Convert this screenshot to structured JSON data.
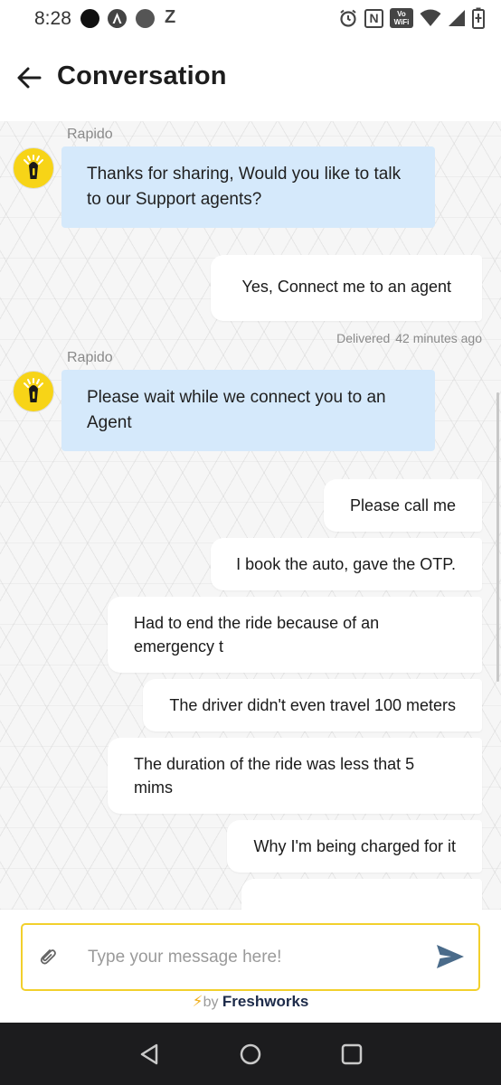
{
  "status_bar": {
    "time": "8:28",
    "icons": [
      "circle-icon",
      "a-circle-icon",
      "dot-icon",
      "z-icon",
      "alarm-icon",
      "nfc-icon",
      "vowifi-icon",
      "wifi-icon",
      "signal-icon",
      "battery-icon"
    ],
    "vowifi_label_top": "Vo",
    "vowifi_label_bottom": "WiFi",
    "z_label": "Z",
    "nfc_label": "N"
  },
  "app_bar": {
    "title": "Conversation"
  },
  "messages": [
    {
      "type": "incoming",
      "sender": "Rapido",
      "text": "Thanks for sharing, Would you like to talk to our Support agents?"
    },
    {
      "type": "outgoing",
      "text": "Yes, Connect me to an agent",
      "status": "Delivered",
      "time": "42 minutes ago"
    },
    {
      "type": "incoming",
      "sender": "Rapido",
      "text": "Please wait while we connect you to an Agent"
    },
    {
      "type": "outgoing",
      "text": "Please call me"
    },
    {
      "type": "outgoing",
      "text": "I book the auto, gave the OTP."
    },
    {
      "type": "outgoing",
      "text": "Had to end the ride because of an emergency t"
    },
    {
      "type": "outgoing",
      "text": "The driver didn't even travel 100 meters"
    },
    {
      "type": "outgoing",
      "text": "The duration of the ride was less that 5 mims"
    },
    {
      "type": "outgoing",
      "text": "Why I'm being charged for it"
    }
  ],
  "composer": {
    "placeholder": "Type your message here!",
    "value": ""
  },
  "footer": {
    "by": "by",
    "brand": "Freshworks"
  },
  "colors": {
    "incoming_bubble": "#d5e9fb",
    "outgoing_bubble": "#ffffff",
    "input_border": "#f2d02c",
    "avatar_bg": "#f7d417",
    "send_icon": "#4a6b8a"
  }
}
